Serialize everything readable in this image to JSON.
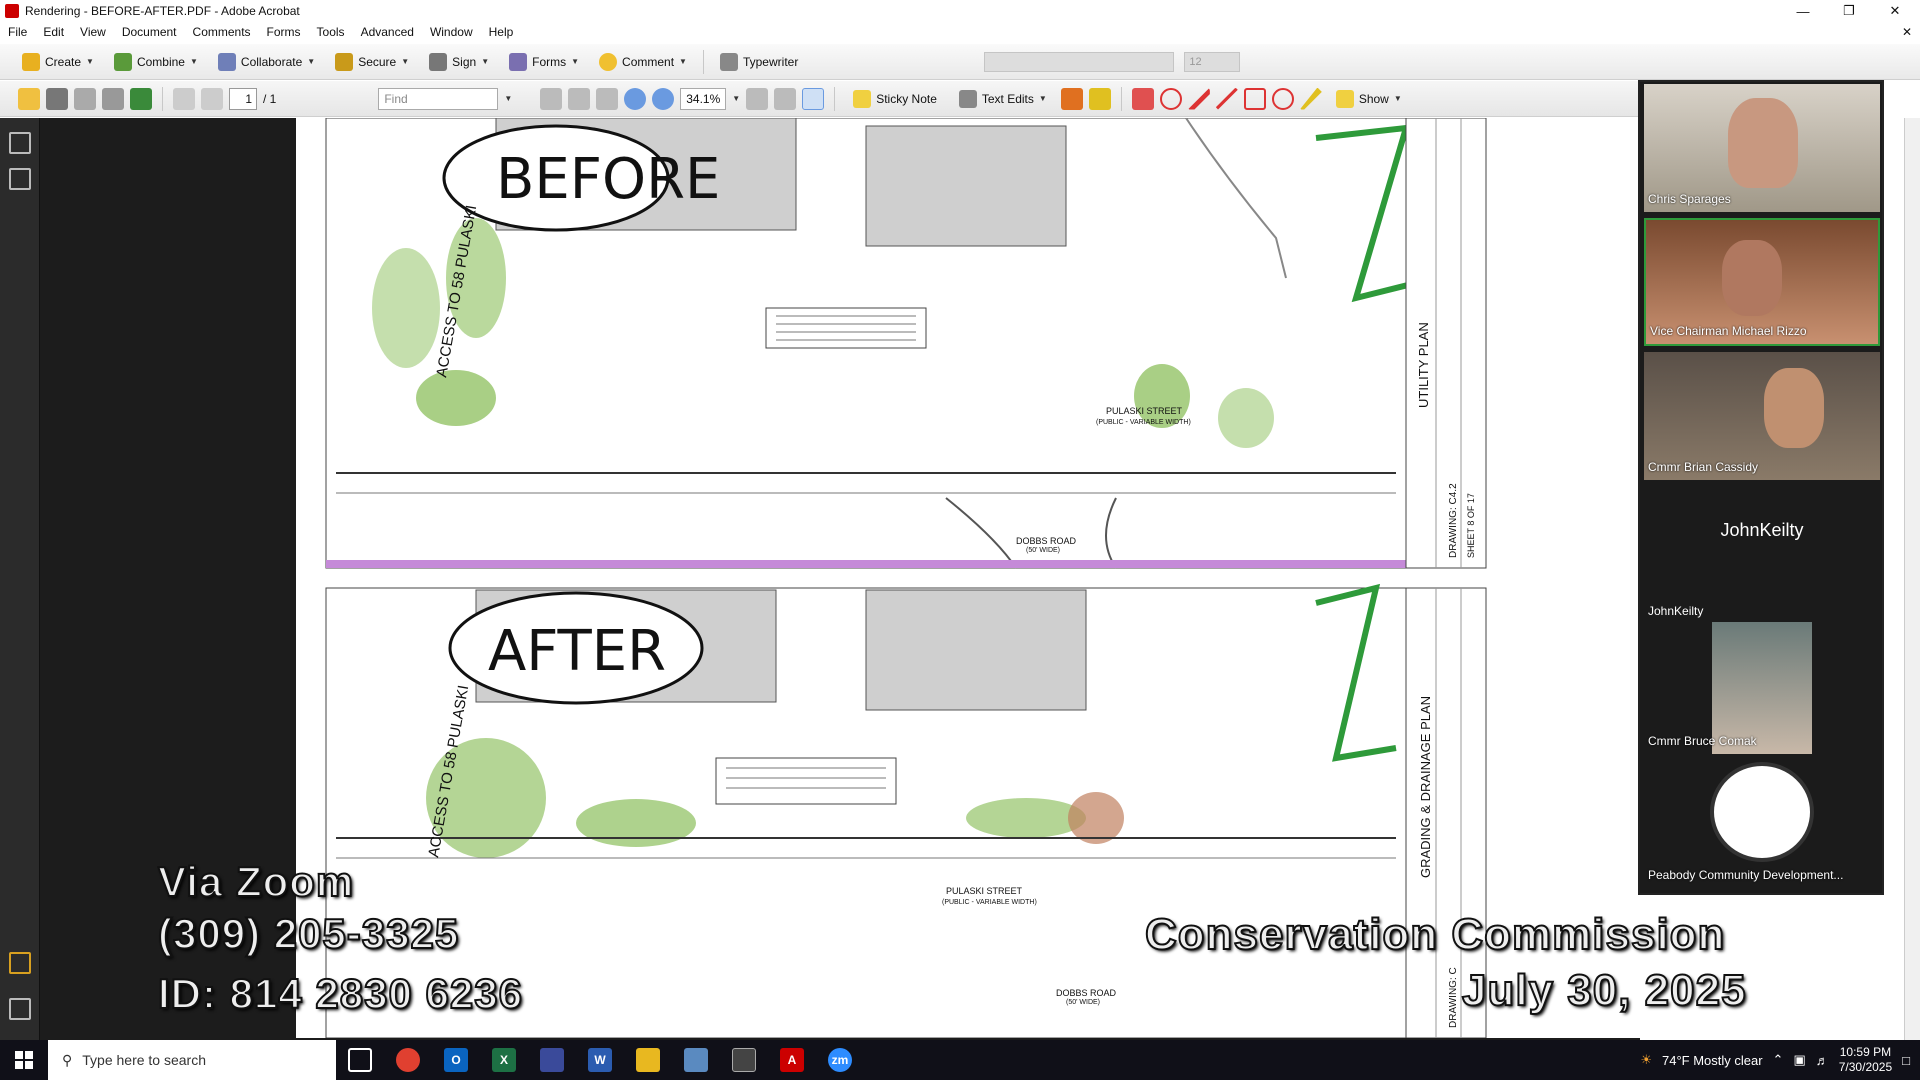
{
  "window": {
    "title": "Rendering - BEFORE-AFTER.PDF - Adobe Acrobat"
  },
  "menu": [
    "File",
    "Edit",
    "View",
    "Document",
    "Comments",
    "Forms",
    "Tools",
    "Advanced",
    "Window",
    "Help"
  ],
  "toolbar": {
    "create": "Create",
    "combine": "Combine",
    "collaborate": "Collaborate",
    "secure": "Secure",
    "sign": "Sign",
    "forms": "Forms",
    "comment": "Comment",
    "typewriter": "Typewriter",
    "font_size": "12"
  },
  "nav": {
    "page": "1",
    "page_total": "/ 1",
    "find_placeholder": "Find",
    "zoom": "34.1%",
    "sticky_note": "Sticky Note",
    "text_edits": "Text Edits",
    "show": "Show"
  },
  "drawing": {
    "before_label": "BEFORE",
    "after_label": "AFTER",
    "street_top": "PULASKI STREET",
    "street_top_sub": "(PUBLIC - VARIABLE WIDTH)",
    "road_top": "DOBBS ROAD",
    "road_top_sub": "(50' WIDE)",
    "access_top": "ACCESS TO 58 PULASKI",
    "utility_plan": "UTILITY PLAN",
    "drawing_top": "DRAWING: C4.2",
    "sheet_top": "SHEET 8 OF 17",
    "street_bottom": "PULASKI STREET",
    "street_bottom_sub": "(PUBLIC - VARIABLE WIDTH)",
    "road_bottom": "DOBBS ROAD",
    "road_bottom_sub": "(50' WIDE)",
    "access_bottom": "ACCESS TO 58 PULASKI",
    "grading_plan": "GRADING & DRAINAGE PLAN",
    "drawing_bottom": "DRAWING: C"
  },
  "overlay": {
    "via_zoom": "Via Zoom",
    "phone": "(309) 205-3325",
    "meeting_id": "ID:  814 2830 6236",
    "commission": "Conservation Commission",
    "date": "July 30, 2025"
  },
  "participants": [
    {
      "name": "Chris Sparages"
    },
    {
      "name": "Vice Chairman Michael Rizzo"
    },
    {
      "name": "Cmmr Brian Cassidy"
    },
    {
      "name": "JohnKeilty",
      "big_label": "JohnKeilty"
    },
    {
      "name": "Cmmr Bruce Comak"
    },
    {
      "name": "Peabody Community Development..."
    }
  ],
  "taskbar": {
    "search_placeholder": "Type here to search",
    "weather": "74°F  Mostly clear",
    "time": "10:59 PM",
    "date": "7/30/2025"
  },
  "colors": {
    "accent_green": "#2e9a3a",
    "purple_line": "#c58ad8",
    "zoom_blue": "#2d8cff"
  }
}
